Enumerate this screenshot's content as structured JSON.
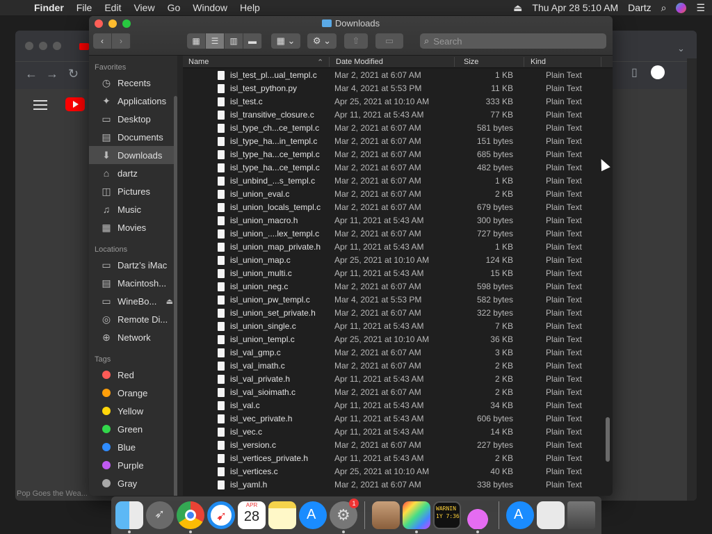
{
  "menubar": {
    "app": "Finder",
    "items": [
      "File",
      "Edit",
      "View",
      "Go",
      "Window",
      "Help"
    ],
    "clock": "Thu Apr 28  5:10 AM",
    "user": "Dartz"
  },
  "browser": {
    "status_text": "Pop Goes the Wea..."
  },
  "finder": {
    "title": "Downloads",
    "search_placeholder": "Search",
    "favorites_header": "Favorites",
    "favorites": [
      {
        "label": "Recents",
        "icon": "clock-icon"
      },
      {
        "label": "Applications",
        "icon": "applications-icon"
      },
      {
        "label": "Desktop",
        "icon": "desktop-icon"
      },
      {
        "label": "Documents",
        "icon": "document-icon"
      },
      {
        "label": "Downloads",
        "icon": "download-icon"
      },
      {
        "label": "dartz",
        "icon": "home-icon"
      },
      {
        "label": "Pictures",
        "icon": "camera-icon"
      },
      {
        "label": "Music",
        "icon": "music-note-icon"
      },
      {
        "label": "Movies",
        "icon": "film-icon"
      }
    ],
    "locations_header": "Locations",
    "locations": [
      {
        "label": "Dartz’s iMac",
        "icon": "computer-icon"
      },
      {
        "label": "Macintosh...",
        "icon": "hard-drive-icon"
      },
      {
        "label": "WineBo...",
        "icon": "disk-image-icon"
      },
      {
        "label": "Remote Di...",
        "icon": "optical-disc-icon"
      },
      {
        "label": "Network",
        "icon": "globe-icon"
      }
    ],
    "tags_header": "Tags",
    "tags": [
      {
        "label": "Red",
        "color": "#ff5b57"
      },
      {
        "label": "Orange",
        "color": "#ff9f0a"
      },
      {
        "label": "Yellow",
        "color": "#ffd60a"
      },
      {
        "label": "Green",
        "color": "#32d74b"
      },
      {
        "label": "Blue",
        "color": "#2f8cff"
      },
      {
        "label": "Purple",
        "color": "#bf5af2"
      },
      {
        "label": "Gray",
        "color": "#a8a8a8"
      }
    ],
    "columns": {
      "name": "Name",
      "date": "Date Modified",
      "size": "Size",
      "kind": "Kind"
    },
    "files": [
      {
        "name": "isl_test_pl...ual_templ.c",
        "date": "Mar 2, 2021 at 6:07 AM",
        "size": "1 KB",
        "kind": "Plain Text"
      },
      {
        "name": "isl_test_python.py",
        "date": "Mar 4, 2021 at 5:53 PM",
        "size": "11 KB",
        "kind": "Plain Text"
      },
      {
        "name": "isl_test.c",
        "date": "Apr 25, 2021 at 10:10 AM",
        "size": "333 KB",
        "kind": "Plain Text"
      },
      {
        "name": "isl_transitive_closure.c",
        "date": "Apr 11, 2021 at 5:43 AM",
        "size": "77 KB",
        "kind": "Plain Text"
      },
      {
        "name": "isl_type_ch...ce_templ.c",
        "date": "Mar 2, 2021 at 6:07 AM",
        "size": "581 bytes",
        "kind": "Plain Text"
      },
      {
        "name": "isl_type_ha...in_templ.c",
        "date": "Mar 2, 2021 at 6:07 AM",
        "size": "151 bytes",
        "kind": "Plain Text"
      },
      {
        "name": "isl_type_ha...ce_templ.c",
        "date": "Mar 2, 2021 at 6:07 AM",
        "size": "685 bytes",
        "kind": "Plain Text"
      },
      {
        "name": "isl_type_ha...ce_templ.c",
        "date": "Mar 2, 2021 at 6:07 AM",
        "size": "482 bytes",
        "kind": "Plain Text"
      },
      {
        "name": "isl_unbind_...s_templ.c",
        "date": "Mar 2, 2021 at 6:07 AM",
        "size": "1 KB",
        "kind": "Plain Text"
      },
      {
        "name": "isl_union_eval.c",
        "date": "Mar 2, 2021 at 6:07 AM",
        "size": "2 KB",
        "kind": "Plain Text"
      },
      {
        "name": "isl_union_locals_templ.c",
        "date": "Mar 2, 2021 at 6:07 AM",
        "size": "679 bytes",
        "kind": "Plain Text"
      },
      {
        "name": "isl_union_macro.h",
        "date": "Apr 11, 2021 at 5:43 AM",
        "size": "300 bytes",
        "kind": "Plain Text"
      },
      {
        "name": "isl_union_....lex_templ.c",
        "date": "Mar 2, 2021 at 6:07 AM",
        "size": "727 bytes",
        "kind": "Plain Text"
      },
      {
        "name": "isl_union_map_private.h",
        "date": "Apr 11, 2021 at 5:43 AM",
        "size": "1 KB",
        "kind": "Plain Text"
      },
      {
        "name": "isl_union_map.c",
        "date": "Apr 25, 2021 at 10:10 AM",
        "size": "124 KB",
        "kind": "Plain Text"
      },
      {
        "name": "isl_union_multi.c",
        "date": "Apr 11, 2021 at 5:43 AM",
        "size": "15 KB",
        "kind": "Plain Text"
      },
      {
        "name": "isl_union_neg.c",
        "date": "Mar 2, 2021 at 6:07 AM",
        "size": "598 bytes",
        "kind": "Plain Text"
      },
      {
        "name": "isl_union_pw_templ.c",
        "date": "Mar 4, 2021 at 5:53 PM",
        "size": "582 bytes",
        "kind": "Plain Text"
      },
      {
        "name": "isl_union_set_private.h",
        "date": "Mar 2, 2021 at 6:07 AM",
        "size": "322 bytes",
        "kind": "Plain Text"
      },
      {
        "name": "isl_union_single.c",
        "date": "Apr 11, 2021 at 5:43 AM",
        "size": "7 KB",
        "kind": "Plain Text"
      },
      {
        "name": "isl_union_templ.c",
        "date": "Apr 25, 2021 at 10:10 AM",
        "size": "36 KB",
        "kind": "Plain Text"
      },
      {
        "name": "isl_val_gmp.c",
        "date": "Mar 2, 2021 at 6:07 AM",
        "size": "3 KB",
        "kind": "Plain Text"
      },
      {
        "name": "isl_val_imath.c",
        "date": "Mar 2, 2021 at 6:07 AM",
        "size": "2 KB",
        "kind": "Plain Text"
      },
      {
        "name": "isl_val_private.h",
        "date": "Apr 11, 2021 at 5:43 AM",
        "size": "2 KB",
        "kind": "Plain Text"
      },
      {
        "name": "isl_val_sioimath.c",
        "date": "Mar 2, 2021 at 6:07 AM",
        "size": "2 KB",
        "kind": "Plain Text"
      },
      {
        "name": "isl_val.c",
        "date": "Apr 11, 2021 at 5:43 AM",
        "size": "34 KB",
        "kind": "Plain Text"
      },
      {
        "name": "isl_vec_private.h",
        "date": "Apr 11, 2021 at 5:43 AM",
        "size": "606 bytes",
        "kind": "Plain Text"
      },
      {
        "name": "isl_vec.c",
        "date": "Apr 11, 2021 at 5:43 AM",
        "size": "14 KB",
        "kind": "Plain Text"
      },
      {
        "name": "isl_version.c",
        "date": "Mar 2, 2021 at 6:07 AM",
        "size": "227 bytes",
        "kind": "Plain Text"
      },
      {
        "name": "isl_vertices_private.h",
        "date": "Apr 11, 2021 at 5:43 AM",
        "size": "2 KB",
        "kind": "Plain Text"
      },
      {
        "name": "isl_vertices.c",
        "date": "Apr 25, 2021 at 10:10 AM",
        "size": "40 KB",
        "kind": "Plain Text"
      },
      {
        "name": "isl_yaml.h",
        "date": "Mar 2, 2021 at 6:07 AM",
        "size": "338 bytes",
        "kind": "Plain Text"
      }
    ]
  },
  "dock": {
    "calendar_month": "APR",
    "calendar_day": "28",
    "system_prefs_badge": "1",
    "console_text": "WARNIN\n1Y 7:36"
  }
}
